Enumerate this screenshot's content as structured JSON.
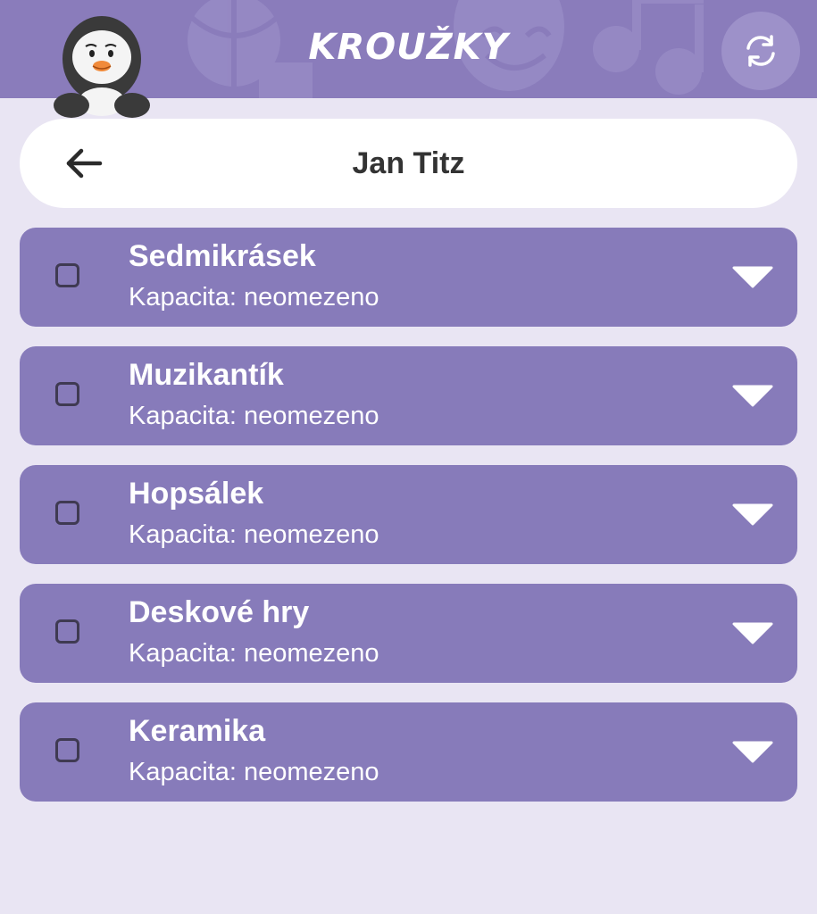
{
  "app": {
    "title": "KROUŽKY"
  },
  "header": {
    "mascot_icon": "penguin-mascot-icon",
    "refresh_icon": "refresh-icon",
    "background_color": "#8a7cbb"
  },
  "child": {
    "name": "Jan Titz",
    "back_icon": "arrow-left-icon"
  },
  "clubs": [
    {
      "name": "Sedmikrásek",
      "capacity": "Kapacita: neomezeno",
      "checked": false
    },
    {
      "name": "Muzikantík",
      "capacity": "Kapacita: neomezeno",
      "checked": false
    },
    {
      "name": "Hopsálek",
      "capacity": "Kapacita: neomezeno",
      "checked": false
    },
    {
      "name": "Deskové hry",
      "capacity": "Kapacita: neomezeno",
      "checked": false
    },
    {
      "name": "Keramika",
      "capacity": "Kapacita: neomezeno",
      "checked": false
    }
  ],
  "colors": {
    "accent": "#877bba",
    "page_background": "#e9e5f3"
  }
}
